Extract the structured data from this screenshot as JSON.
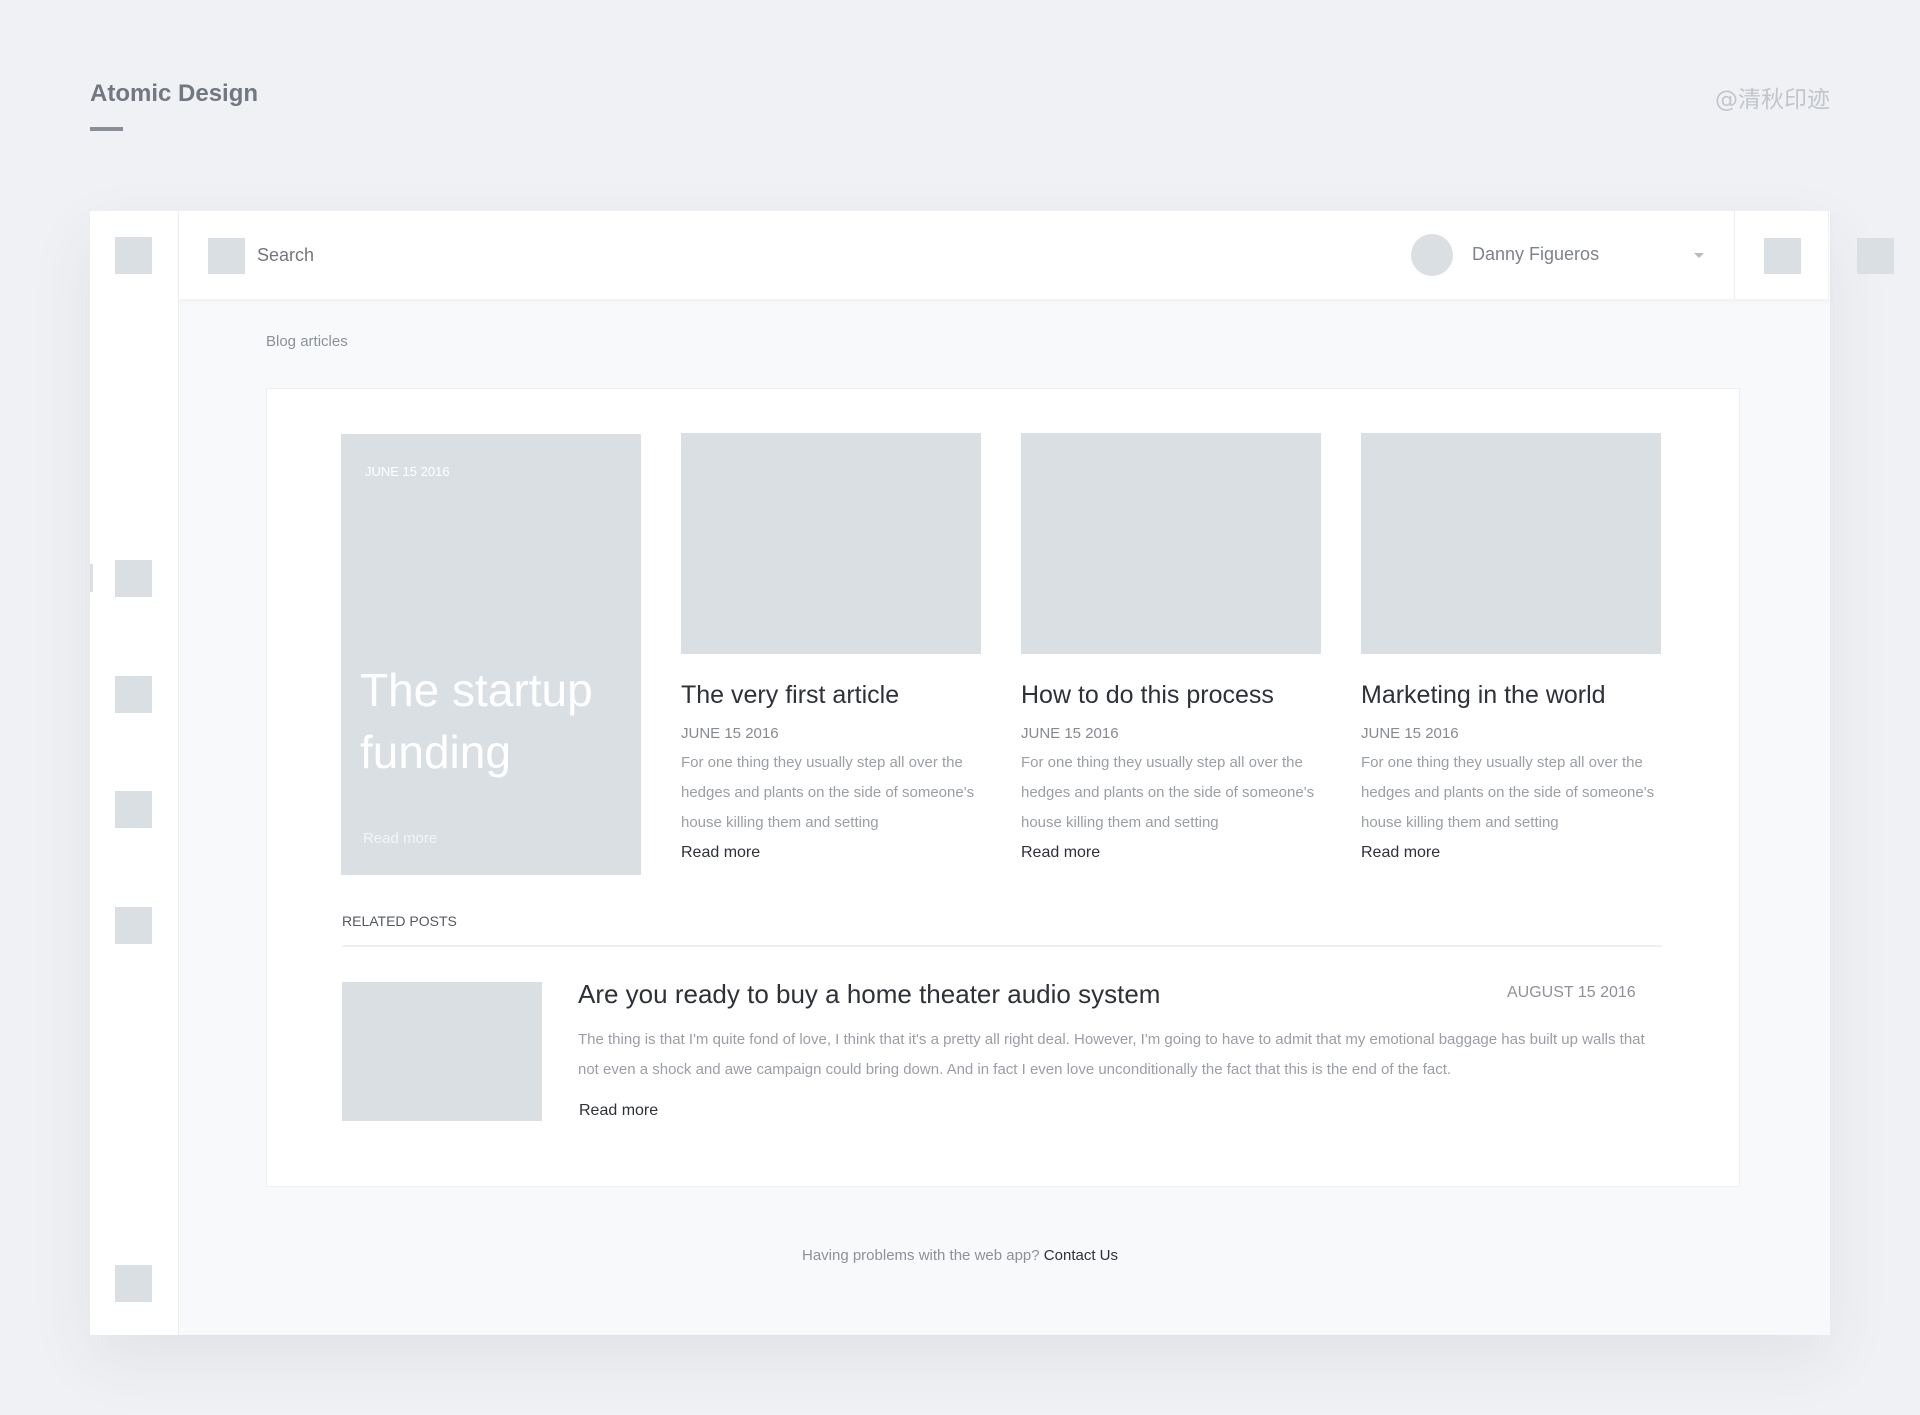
{
  "header": {
    "title": "Atomic Design",
    "watermark": "@清秋印迹"
  },
  "topbar": {
    "search_label": "Search",
    "user_name": "Danny Figueros"
  },
  "breadcrumb": "Blog articles",
  "featured": {
    "date": "JUNE 15 2016",
    "title": "The startup funding",
    "read_more": "Read more"
  },
  "articles": [
    {
      "title": "The very first article",
      "date": "JUNE 15 2016",
      "excerpt": "For one thing they usually step all over the hedges and plants on the side of someone's house killing them and setting",
      "read_more": "Read more"
    },
    {
      "title": "How to do this process",
      "date": "JUNE 15 2016",
      "excerpt": "For one thing they usually step all over the hedges and plants on the side of someone's house killing them and setting",
      "read_more": "Read more"
    },
    {
      "title": "Marketing in the world",
      "date": "JUNE 15 2016",
      "excerpt": "For one thing they usually step all over the hedges and plants on the side of someone's house killing them and setting",
      "read_more": "Read more"
    }
  ],
  "related": {
    "heading": "RELATED POSTS",
    "title": "Are you ready to buy a home theater audio system",
    "date": "AUGUST 15 2016",
    "excerpt": "The thing is that I'm quite fond of love, I think that it's a pretty all right deal. However, I'm going to have to admit that my emotional baggage has built up walls that not even a shock and awe campaign could bring down. And in fact I even love unconditionally the fact that this is the end of the fact.",
    "read_more": "Read more"
  },
  "footer": {
    "text": "Having problems with the web app?",
    "link": "Contact Us"
  },
  "icons": {
    "placeholder": "square-placeholder-icon",
    "avatar": "user-avatar",
    "caret": "chevron-down-icon"
  },
  "colors": {
    "background": "#eff1f4",
    "placeholder": "#dadfe3",
    "text_dark": "#2e3138",
    "text_muted": "#9a9ea5"
  }
}
